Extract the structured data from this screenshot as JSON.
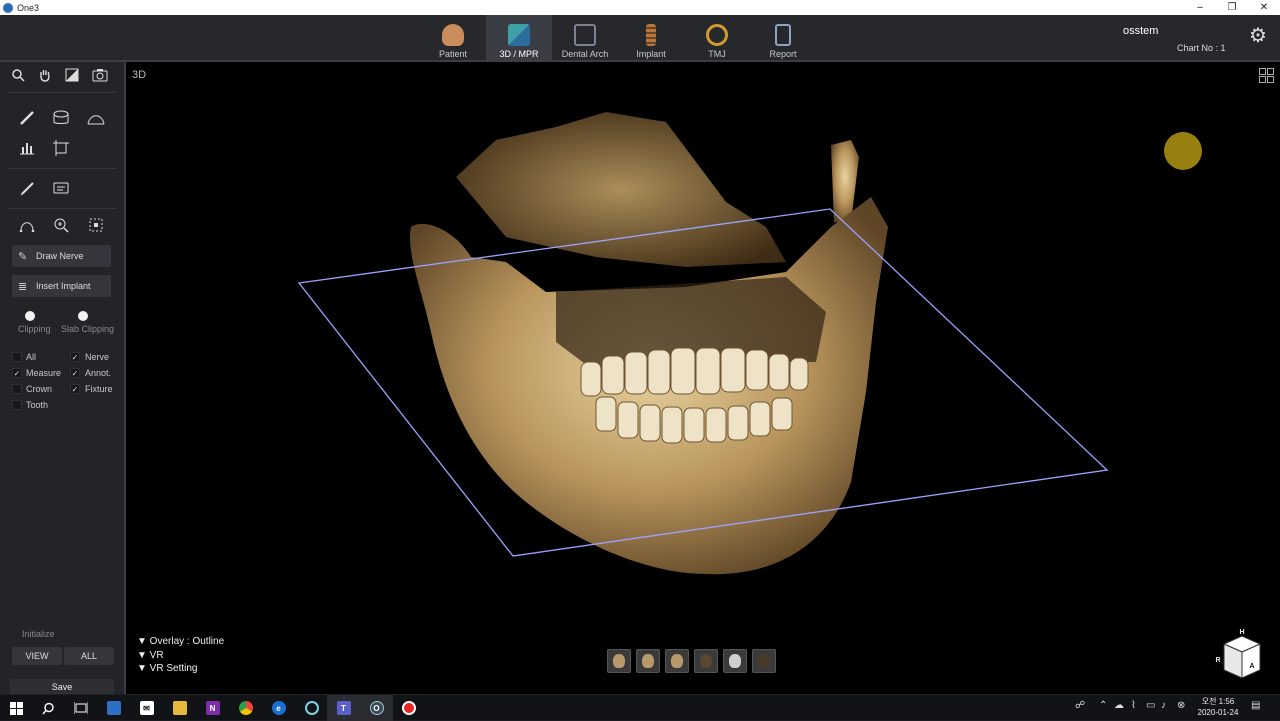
{
  "window": {
    "title": "One3",
    "minimize": "–",
    "restore": "❐",
    "close": "✕"
  },
  "header": {
    "tabs": [
      {
        "label": "Patient",
        "icon": "patient-icon",
        "color": "#c98c5a"
      },
      {
        "label": "3D / MPR",
        "icon": "3d-mpr-icon",
        "color": "#3fa0a8",
        "active": true
      },
      {
        "label": "Dental Arch",
        "icon": "dental-arch-icon",
        "color": "#7d8394"
      },
      {
        "label": "Implant",
        "icon": "implant-icon",
        "color": "#b7773d"
      },
      {
        "label": "TMJ",
        "icon": "tmj-icon",
        "color": "#d09a2c"
      },
      {
        "label": "Report",
        "icon": "report-icon",
        "color": "#8fa2c8"
      }
    ],
    "user": "osstem",
    "chart_no": "Chart No : 1",
    "settings_icon": "⚙"
  },
  "sidebar": {
    "top_tools": [
      "🔍",
      "✋",
      "◩",
      "📷"
    ],
    "draw_nerve": "Draw Nerve",
    "insert_implant": "Insert Implant",
    "clipping": "Clipping",
    "slab_clipping": "Slab Clipping",
    "checks": [
      {
        "label": "All",
        "checked": false
      },
      {
        "label": "Nerve",
        "checked": true
      },
      {
        "label": "Measure",
        "checked": true
      },
      {
        "label": "Annot.",
        "checked": true
      },
      {
        "label": "Crown",
        "checked": false
      },
      {
        "label": "Fixture",
        "checked": true
      },
      {
        "label": "Tooth",
        "checked": false
      }
    ],
    "initialize": "Initialize",
    "view_btn": "VIEW",
    "all_btn": "ALL",
    "save_btn": "Save"
  },
  "viewport": {
    "label": "3D",
    "overlay": "▼ Overlay : Outline",
    "vr": "▼ VR",
    "vr_setting": "▼ VR Setting",
    "cube_h": "H",
    "cube_r": "R",
    "cube_a": "A"
  },
  "taskbar": {
    "clock_time": "오전 1:56",
    "clock_date": "2020-01-24"
  }
}
